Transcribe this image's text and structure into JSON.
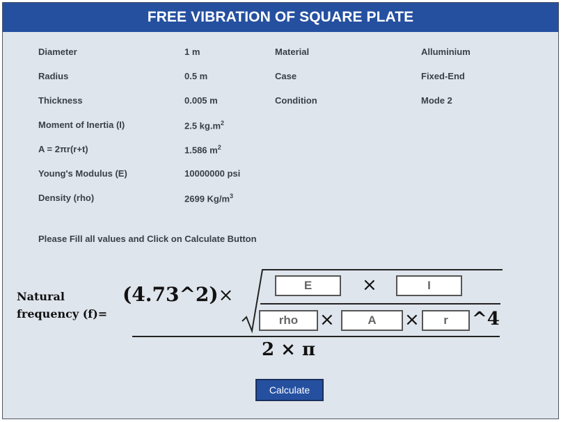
{
  "header": {
    "title": "FREE VIBRATION OF SQUARE PLATE"
  },
  "params": {
    "diameter": {
      "label": "Diameter",
      "value": "1 m"
    },
    "radius": {
      "label": "Radius",
      "value": "0.5 m"
    },
    "thickness": {
      "label": "Thickness",
      "value": "0.005 m"
    },
    "inertia": {
      "label": "Moment of Inertia (I)",
      "value": "2.5 kg.m",
      "sup": "2"
    },
    "area": {
      "label": "A = 2πr(r+t)",
      "value": "1.586 m",
      "sup": "2"
    },
    "youngs": {
      "label": "Young's Modulus (E)",
      "value": "10000000 psi"
    },
    "density": {
      "label": "Density (rho)",
      "value": "2699 Kg/m",
      "sup": "3"
    },
    "material": {
      "label": "Material",
      "value": "Alluminium"
    },
    "case": {
      "label": "Case",
      "value": "Fixed-End"
    },
    "condition": {
      "label": "Condition",
      "value": "Mode 2"
    }
  },
  "instruction": "Please Fill all values and Click on Calculate Button",
  "formula": {
    "label_line1": "Natural",
    "label_line2": "frequency (f)=",
    "coefficient": "(4.73^2)",
    "times": "×",
    "power": "^4",
    "denominator": "2 × π",
    "inputs": {
      "E": "E",
      "I": "I",
      "rho": "rho",
      "A": "A",
      "r": "r"
    }
  },
  "calculate_button": "Calculate"
}
